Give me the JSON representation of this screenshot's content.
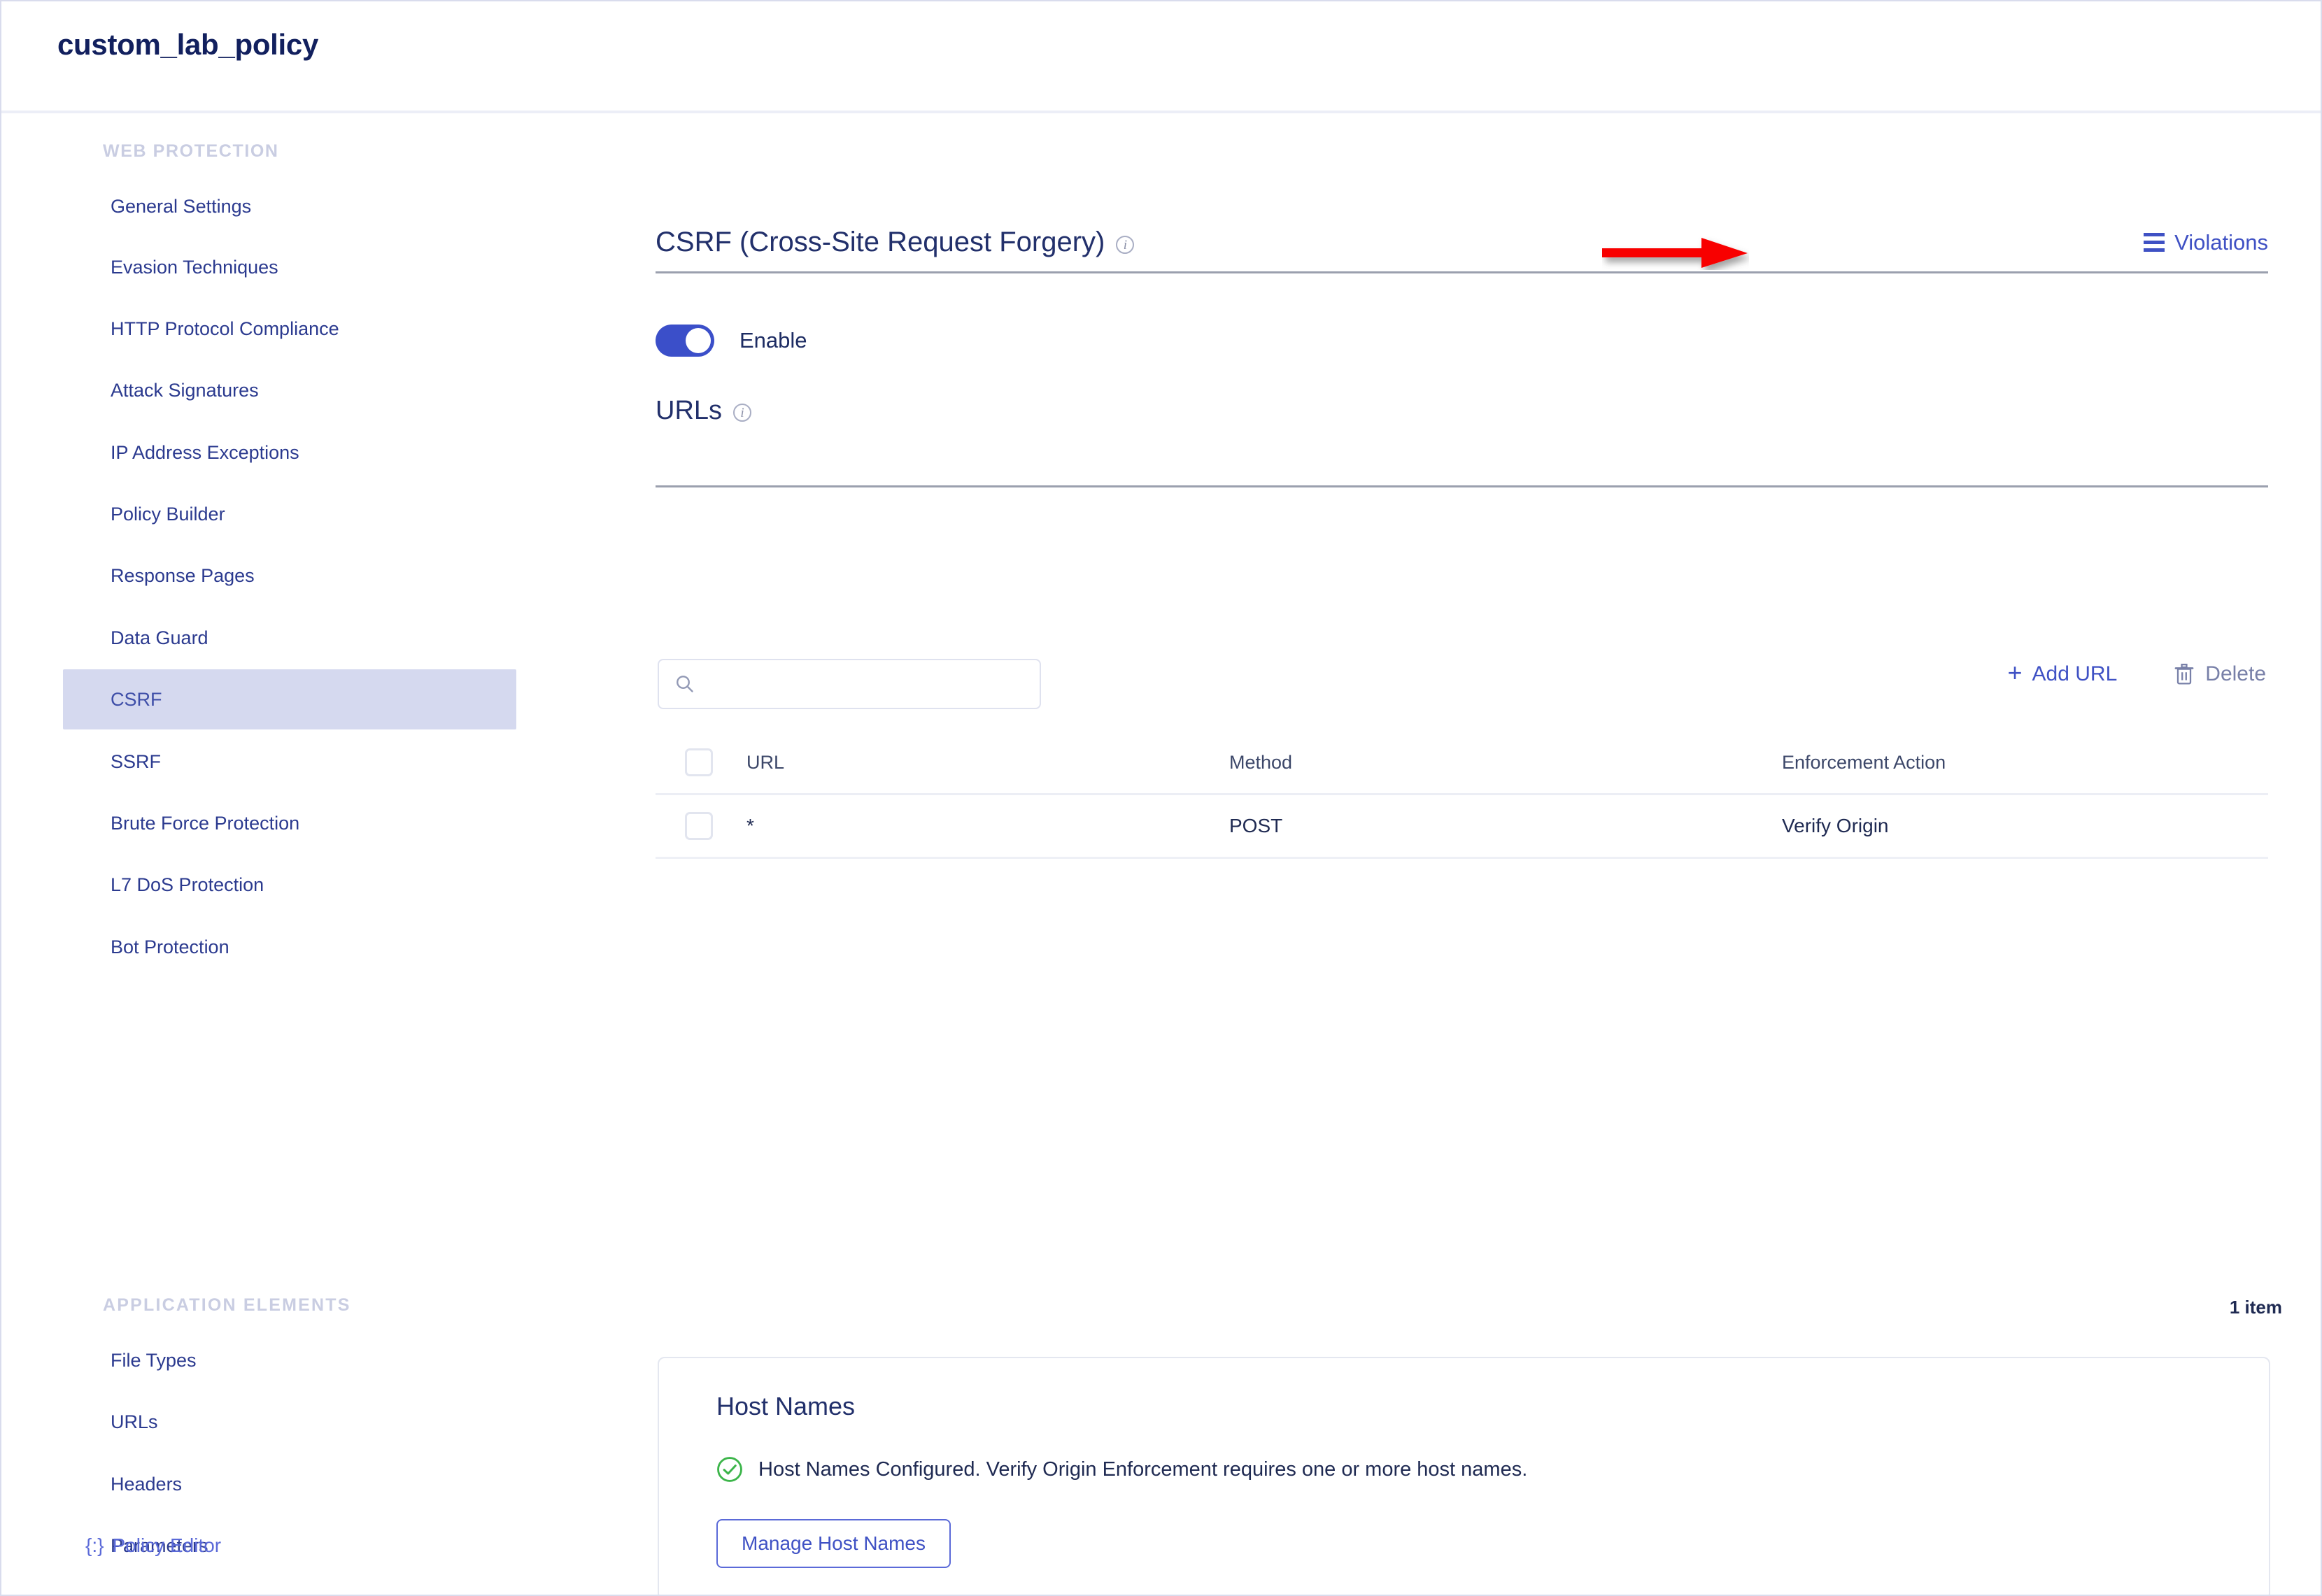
{
  "header": {
    "title": "custom_lab_policy"
  },
  "sidebar": {
    "groups": [
      {
        "label": "WEB PROTECTION",
        "items": [
          {
            "label": "General Settings",
            "active": false
          },
          {
            "label": "Evasion Techniques",
            "active": false
          },
          {
            "label": "HTTP Protocol Compliance",
            "active": false
          },
          {
            "label": "Attack Signatures",
            "active": false
          },
          {
            "label": "IP Address Exceptions",
            "active": false
          },
          {
            "label": "Policy Builder",
            "active": false
          },
          {
            "label": "Response Pages",
            "active": false
          },
          {
            "label": "Data Guard",
            "active": false
          },
          {
            "label": "CSRF",
            "active": true
          },
          {
            "label": "SSRF",
            "active": false
          },
          {
            "label": "Brute Force Protection",
            "active": false
          },
          {
            "label": "L7 DoS Protection",
            "active": false
          },
          {
            "label": "Bot Protection",
            "active": false
          }
        ]
      },
      {
        "label": "APPLICATION ELEMENTS",
        "items": [
          {
            "label": "File Types",
            "active": false
          },
          {
            "label": "URLs",
            "active": false
          },
          {
            "label": "Headers",
            "active": false
          },
          {
            "label": "Parameters",
            "active": false
          }
        ]
      }
    ],
    "policy_editor": {
      "braces": "{:}",
      "label": "Policy Editor"
    }
  },
  "main": {
    "section_title": "CSRF (Cross-Site Request Forgery)",
    "violations_label": "Violations",
    "enable_label": "Enable",
    "enable_on": true,
    "urls_title": "URLs",
    "search": {
      "value": "",
      "placeholder": ""
    },
    "add_url_label": "Add URL",
    "delete_label": "Delete",
    "table": {
      "columns": [
        "URL",
        "Method",
        "Enforcement Action"
      ],
      "rows": [
        {
          "url": "*",
          "method": "POST",
          "enforcement_action": "Verify Origin"
        }
      ]
    },
    "item_count": "1 item",
    "host_names": {
      "title": "Host Names",
      "status_message": "Host Names Configured. Verify Origin Enforcement requires one or more host names.",
      "button_label": "Manage Host Names"
    }
  },
  "colors": {
    "accent_blue": "#3f51c4",
    "toggle_on": "#3b4fc9",
    "sidebar_active_bg": "#d5d9ef",
    "annotation_red": "#f80000",
    "success_green": "#3cb54a"
  }
}
